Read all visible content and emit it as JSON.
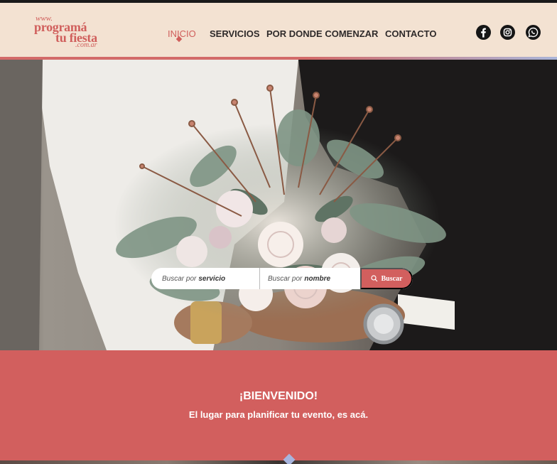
{
  "logo": {
    "www": "www.",
    "line1": "programá",
    "line2": "tu fiesta",
    "domain": ".com.ar"
  },
  "nav": {
    "items": [
      {
        "label": "INICIO",
        "active": true
      },
      {
        "label": "SERVICIOS",
        "active": false
      },
      {
        "label": "POR DONDE COMENZAR",
        "active": false
      },
      {
        "label": "CONTACTO",
        "active": false
      }
    ]
  },
  "social": {
    "icons": [
      "facebook-icon",
      "instagram-icon",
      "whatsapp-icon"
    ]
  },
  "search": {
    "service_prefix": "Buscar por",
    "service_strong": "servicio",
    "name_prefix": "Buscar por",
    "name_strong": "nombre",
    "button_label": "Buscar"
  },
  "welcome": {
    "title": "¡BIENVENIDO!",
    "subtitle": "El lugar para planificar tu evento, es acá."
  },
  "colors": {
    "brand": "#d25f5e",
    "header_bg": "#f3e2d2",
    "accent": "#a7b4dd"
  }
}
